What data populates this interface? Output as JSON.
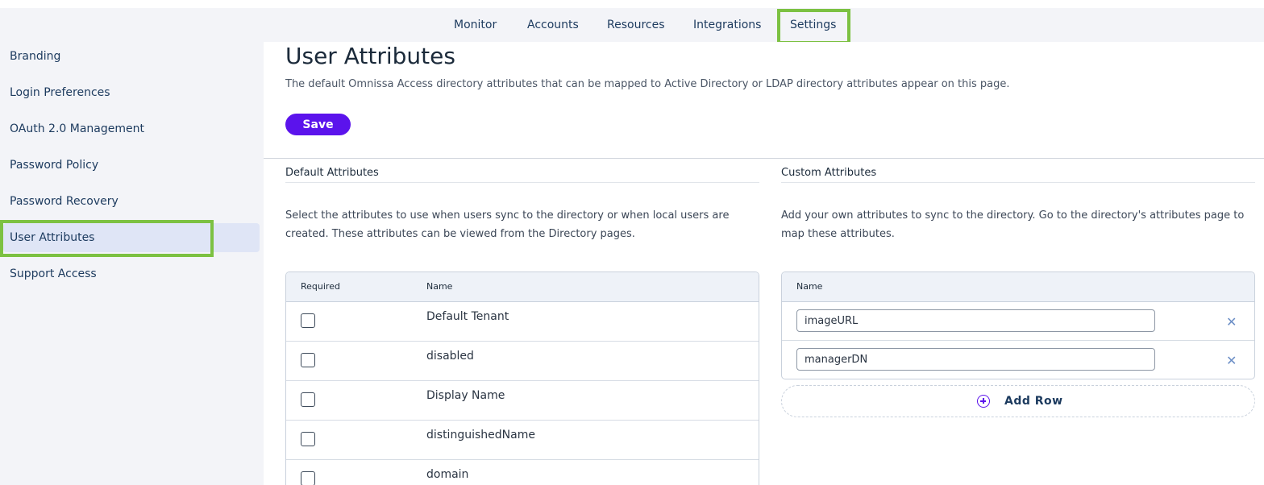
{
  "topnav": {
    "items": [
      "Monitor",
      "Accounts",
      "Resources",
      "Integrations",
      "Settings"
    ],
    "active": "Settings"
  },
  "sidebar": {
    "items": [
      "Branding",
      "Login Preferences",
      "OAuth 2.0 Management",
      "Password Policy",
      "Password Recovery",
      "User Attributes",
      "Support Access"
    ],
    "active": "User Attributes"
  },
  "page": {
    "title": "User Attributes",
    "description": "The default Omnissa Access directory attributes that can be mapped to Active Directory or LDAP directory attributes appear on this page.",
    "save_label": "Save"
  },
  "default_attributes": {
    "title": "Default Attributes",
    "description": "Select the attributes to use when users sync to the directory or when local users are created. These attributes can be viewed from the Directory pages.",
    "col_required": "Required",
    "col_name": "Name",
    "rows": [
      {
        "name": "Default Tenant",
        "required": false
      },
      {
        "name": "disabled",
        "required": false
      },
      {
        "name": "Display Name",
        "required": false
      },
      {
        "name": "distinguishedName",
        "required": false
      },
      {
        "name": "domain",
        "required": false
      }
    ]
  },
  "custom_attributes": {
    "title": "Custom Attributes",
    "description": "Add your own attributes to sync to the directory. Go to the directory's attributes page to map these attributes.",
    "col_name": "Name",
    "rows": [
      {
        "value": "imageURL"
      },
      {
        "value": "managerDN"
      }
    ],
    "add_row_label": "Add Row"
  },
  "colors": {
    "accent": "#5b13ec",
    "highlight": "#7cc142",
    "sidebar_active": "#dfe5f6"
  }
}
